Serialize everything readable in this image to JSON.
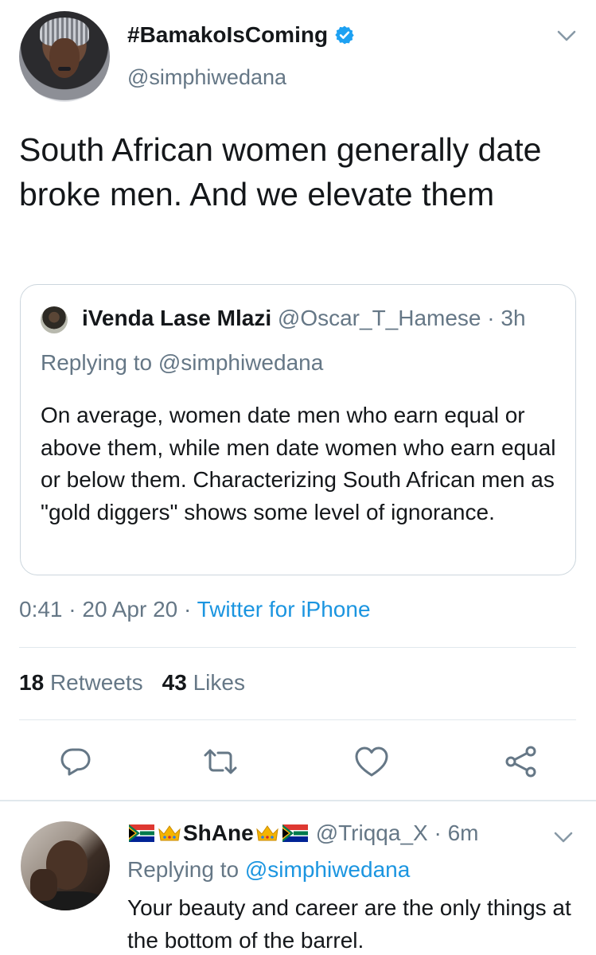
{
  "tweet": {
    "display_name": "#BamakoIsComing",
    "handle": "@simphiwedana",
    "verified_icon": "verified-badge-icon",
    "text": "South African women generally date broke men. And we elevate them",
    "quote": {
      "name": "iVenda Lase Mlazi",
      "meta": "@Oscar_T_Hamese · 3h",
      "replying_prefix": "Replying to ",
      "replying_to": "@simphiwedana",
      "text": "On average, women date men who earn equal or above them, while men date women who earn equal or below them. Characterizing South African men as \"gold diggers\" shows some level of ignorance."
    },
    "time": "0:41 · 20 Apr 20 · ",
    "source": "Twitter for iPhone",
    "retweets_count": "18",
    "retweets_label": "Retweets",
    "likes_count": "43",
    "likes_label": "Likes"
  },
  "actions": [
    "reply-icon",
    "retweet-icon",
    "like-icon",
    "share-icon"
  ],
  "reply": {
    "name": "ShAne",
    "meta": "@Triqqa_X · 6m",
    "replying_prefix": "Replying to ",
    "replying_to": "@simphiwedana",
    "text": "Your beauty and career are the only things at the bottom of the barrel."
  },
  "colors": {
    "accent": "#1b95e0",
    "muted": "#657786",
    "text": "#14171a",
    "border": "#ccd6dd"
  }
}
